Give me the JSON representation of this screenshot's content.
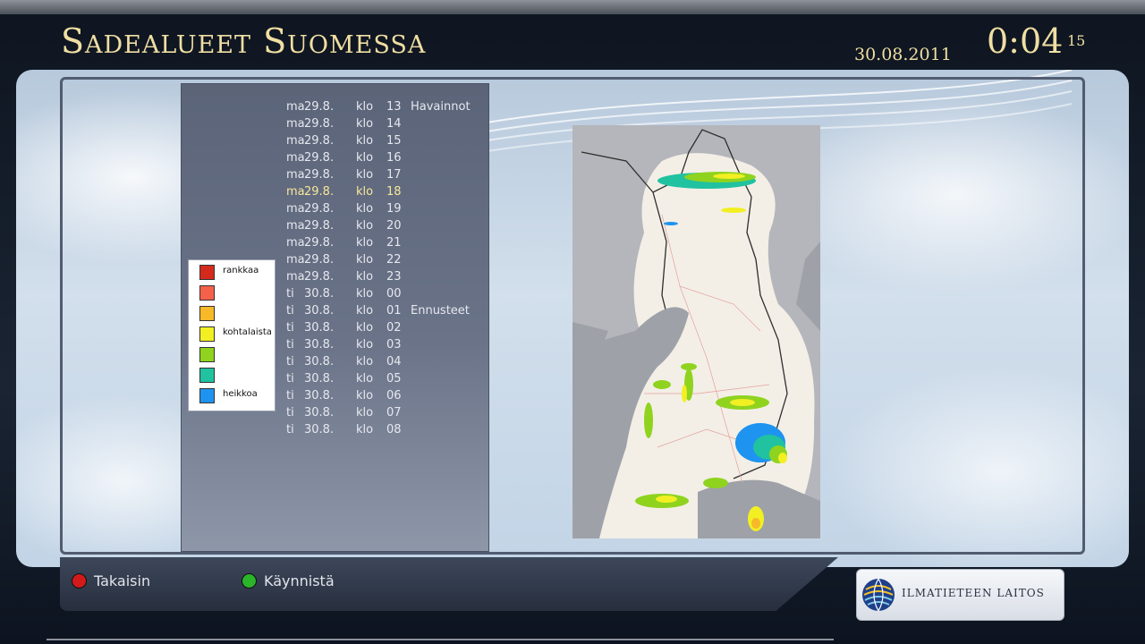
{
  "header": {
    "title": "Sadealueet Suomessa",
    "date": "30.08.2011",
    "clock": "0:04",
    "clock_seconds": "15"
  },
  "time_list": [
    {
      "day": "ma",
      "date": "29.8.",
      "klo": "klo",
      "hour": "13",
      "note": "Havainnot"
    },
    {
      "day": "ma",
      "date": "29.8.",
      "klo": "klo",
      "hour": "14",
      "note": ""
    },
    {
      "day": "ma",
      "date": "29.8.",
      "klo": "klo",
      "hour": "15",
      "note": ""
    },
    {
      "day": "ma",
      "date": "29.8.",
      "klo": "klo",
      "hour": "16",
      "note": ""
    },
    {
      "day": "ma",
      "date": "29.8.",
      "klo": "klo",
      "hour": "17",
      "note": ""
    },
    {
      "day": "ma",
      "date": "29.8.",
      "klo": "klo",
      "hour": "18",
      "note": "",
      "selected": true
    },
    {
      "day": "ma",
      "date": "29.8.",
      "klo": "klo",
      "hour": "19",
      "note": ""
    },
    {
      "day": "ma",
      "date": "29.8.",
      "klo": "klo",
      "hour": "20",
      "note": ""
    },
    {
      "day": "ma",
      "date": "29.8.",
      "klo": "klo",
      "hour": "21",
      "note": ""
    },
    {
      "day": "ma",
      "date": "29.8.",
      "klo": "klo",
      "hour": "22",
      "note": ""
    },
    {
      "day": "ma",
      "date": "29.8.",
      "klo": "klo",
      "hour": "23",
      "note": ""
    },
    {
      "day": "ti",
      "date": "30.8.",
      "klo": "klo",
      "hour": "00",
      "note": ""
    },
    {
      "day": "ti",
      "date": "30.8.",
      "klo": "klo",
      "hour": "01",
      "note": "Ennusteet"
    },
    {
      "day": "ti",
      "date": "30.8.",
      "klo": "klo",
      "hour": "02",
      "note": ""
    },
    {
      "day": "ti",
      "date": "30.8.",
      "klo": "klo",
      "hour": "03",
      "note": ""
    },
    {
      "day": "ti",
      "date": "30.8.",
      "klo": "klo",
      "hour": "04",
      "note": ""
    },
    {
      "day": "ti",
      "date": "30.8.",
      "klo": "klo",
      "hour": "05",
      "note": ""
    },
    {
      "day": "ti",
      "date": "30.8.",
      "klo": "klo",
      "hour": "06",
      "note": ""
    },
    {
      "day": "ti",
      "date": "30.8.",
      "klo": "klo",
      "hour": "07",
      "note": ""
    },
    {
      "day": "ti",
      "date": "30.8.",
      "klo": "klo",
      "hour": "08",
      "note": ""
    }
  ],
  "legend": [
    {
      "label": "rankkaa",
      "color": "#d42a1e"
    },
    {
      "label": "",
      "color": "#f4604a"
    },
    {
      "label": "",
      "color": "#f7b928"
    },
    {
      "label": "kohtalaista",
      "color": "#f2ef23"
    },
    {
      "label": "",
      "color": "#8fd31f"
    },
    {
      "label": "",
      "color": "#20c2a0"
    },
    {
      "label": "heikkoa",
      "color": "#1e93f0"
    }
  ],
  "footer": {
    "back_label": "Takaisin",
    "back_color": "#d21a1a",
    "start_label": "Käynnistä",
    "start_color": "#2ab52a",
    "logo_text": "ILMATIETEEN LAITOS"
  },
  "icons": {
    "back_key": "red-circle-icon",
    "start_key": "green-circle-icon",
    "logo": "fmi-globe-logo-icon"
  }
}
